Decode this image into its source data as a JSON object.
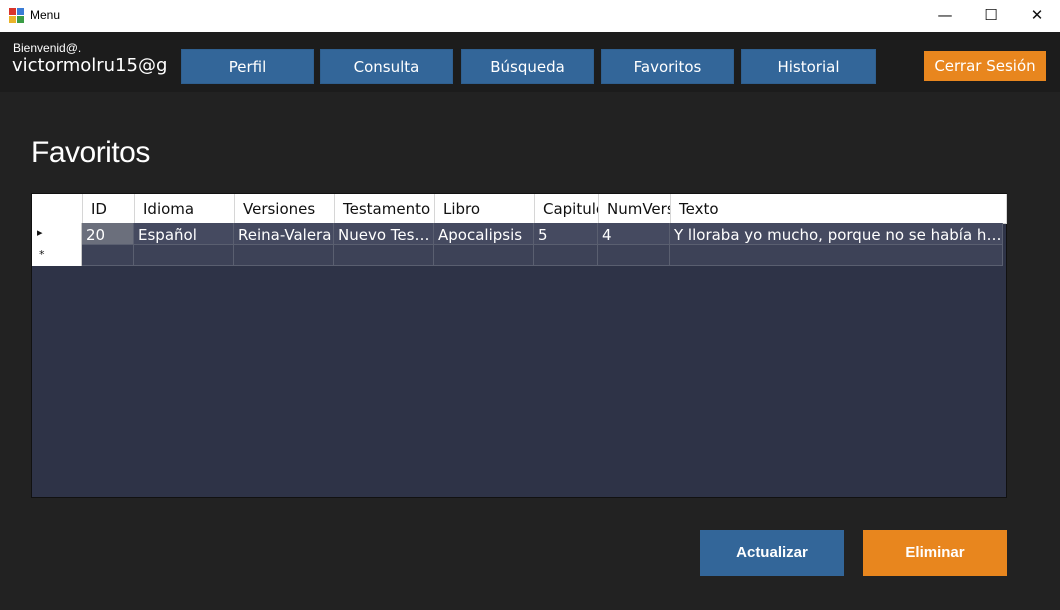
{
  "window": {
    "title": "Menu",
    "minimize_glyph": "—",
    "maximize_glyph": "☐",
    "close_glyph": "✕",
    "icon": "app-window-icon"
  },
  "header": {
    "welcome": "Bienvenid@.",
    "username": "victormolru15@g",
    "nav": [
      "Perfil",
      "Consulta",
      "Búsqueda",
      "Favoritos",
      "Historial"
    ],
    "logout": "Cerrar Sesión"
  },
  "page": {
    "title": "Favoritos"
  },
  "table": {
    "columns": [
      "ID",
      "Idioma",
      "Versiones",
      "Testamento",
      "Libro",
      "Capitulo",
      "NumVersiculo",
      "Texto"
    ],
    "rows": [
      [
        "20",
        "Español",
        "Reina-Valera",
        "Nuevo Testamento",
        "Apocalipsis",
        "5",
        "4",
        "Y lloraba yo mucho, porque no se había hallado a ninguno digno"
      ]
    ],
    "new_row_marker": "*",
    "current_row_marker": "▸"
  },
  "actions": {
    "update": "Actualizar",
    "delete": "Eliminar"
  },
  "colors": {
    "accent_blue": "#336699",
    "accent_orange": "#E8861E",
    "background": "#222222",
    "grid_background": "#2E3347"
  }
}
